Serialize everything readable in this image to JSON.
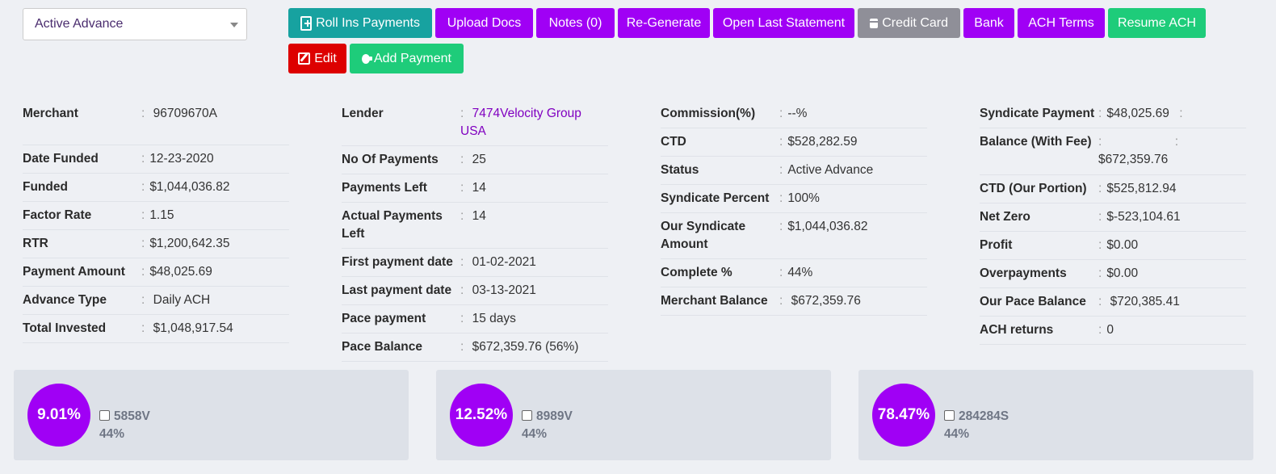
{
  "status_select": {
    "value": "Active Advance"
  },
  "buttons": {
    "roll_ins": "Roll Ins Payments",
    "upload_docs": "Upload Docs",
    "notes": "Notes (0)",
    "regenerate": "Re-Generate",
    "open_last_statement": "Open Last Statement",
    "credit_card": "Credit Card",
    "bank": "Bank",
    "ach_terms": "ACH Terms",
    "resume_ach": "Resume ACH",
    "edit": "Edit",
    "add_payment": "Add Payment"
  },
  "col1": [
    {
      "label": "Merchant",
      "value": "96709670A"
    },
    {
      "label": "Date Funded",
      "value": "12-23-2020"
    },
    {
      "label": "Funded",
      "value": "$1,044,036.82"
    },
    {
      "label": "Factor Rate",
      "value": "1.15"
    },
    {
      "label": "RTR",
      "value": "$1,200,642.35"
    },
    {
      "label": "Payment Amount",
      "value": "$48,025.69"
    },
    {
      "label": "Advance Type",
      "value": "Daily ACH"
    },
    {
      "label": "Total Invested",
      "value": "$1,048,917.54"
    }
  ],
  "col2": [
    {
      "label": "Lender",
      "value": "7474Velocity Group USA"
    },
    {
      "label": "No Of Payments",
      "value": "25"
    },
    {
      "label": "Payments Left",
      "value": "14"
    },
    {
      "label": "Actual Payments Left",
      "value": "14"
    },
    {
      "label": "First payment date",
      "value": "01-02-2021"
    },
    {
      "label": "Last payment date",
      "value": "03-13-2021"
    },
    {
      "label": "Pace payment",
      "value": "15 days"
    },
    {
      "label": "Pace Balance",
      "value": "$672,359.76 (56%)"
    }
  ],
  "col3": [
    {
      "label": "Commission(%)",
      "value": "--%"
    },
    {
      "label": "CTD",
      "value": "$528,282.59"
    },
    {
      "label": "Status",
      "value": "Active Advance"
    },
    {
      "label": "Syndicate Percent",
      "value": "100%"
    },
    {
      "label": "Our Syndicate Amount",
      "value": "$1,044,036.82"
    },
    {
      "label": "Complete %",
      "value": "44%"
    },
    {
      "label": "Merchant Balance",
      "value": "$672,359.76"
    }
  ],
  "col4": [
    {
      "label": "Syndicate Payment",
      "value": "$48,025.69"
    },
    {
      "label": "Balance (With Fee)",
      "value": "$672,359.76"
    },
    {
      "label": "CTD (Our Portion)",
      "value": "$525,812.94"
    },
    {
      "label": "Net Zero",
      "value": "$-523,104.61"
    },
    {
      "label": "Profit",
      "value": "$0.00"
    },
    {
      "label": "Overpayments",
      "value": "$0.00"
    },
    {
      "label": "Our Pace Balance",
      "value": "$720,385.41"
    },
    {
      "label": "ACH returns",
      "value": "0"
    }
  ],
  "cards": [
    {
      "percent": "9.01%",
      "name": "5858V",
      "complete": "44%"
    },
    {
      "percent": "12.52%",
      "name": "8989V",
      "complete": "44%"
    },
    {
      "percent": "78.47%",
      "name": "284284S",
      "complete": "44%"
    }
  ],
  "colors": {
    "purple": "#a000f5",
    "teal": "#17a2a0",
    "green": "#1ecc7a",
    "red": "#dd0000",
    "gray": "#8f8f98"
  }
}
